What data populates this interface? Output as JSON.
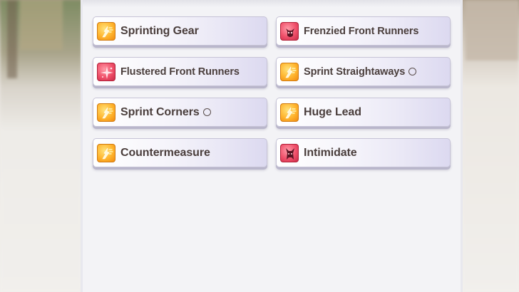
{
  "skills": [
    {
      "label": "Sprinting Gear",
      "icon": "speed-up-icon",
      "color": "gold"
    },
    {
      "label": "Frenzied Front Runners",
      "icon": "devil-icon",
      "color": "red"
    },
    {
      "label": "Flustered Front Runners",
      "icon": "sparkle-debuff-icon",
      "color": "red"
    },
    {
      "label": "Sprint Straightaways",
      "icon": "speed-up-icon",
      "color": "gold",
      "mark": "○"
    },
    {
      "label": "Sprint Corners",
      "icon": "speed-up-icon",
      "color": "gold",
      "mark": "○"
    },
    {
      "label": "Huge Lead",
      "icon": "speed-up-icon",
      "color": "gold"
    },
    {
      "label": "Countermeasure",
      "icon": "speed-up-icon",
      "color": "gold"
    },
    {
      "label": "Intimidate",
      "icon": "wolf-icon",
      "color": "red"
    }
  ],
  "colors": {
    "gold_icon": "#ffb52e",
    "red_icon": "#f0506a",
    "label_text": "#4a3e3c",
    "panel_bg": "#f3f3f6"
  }
}
